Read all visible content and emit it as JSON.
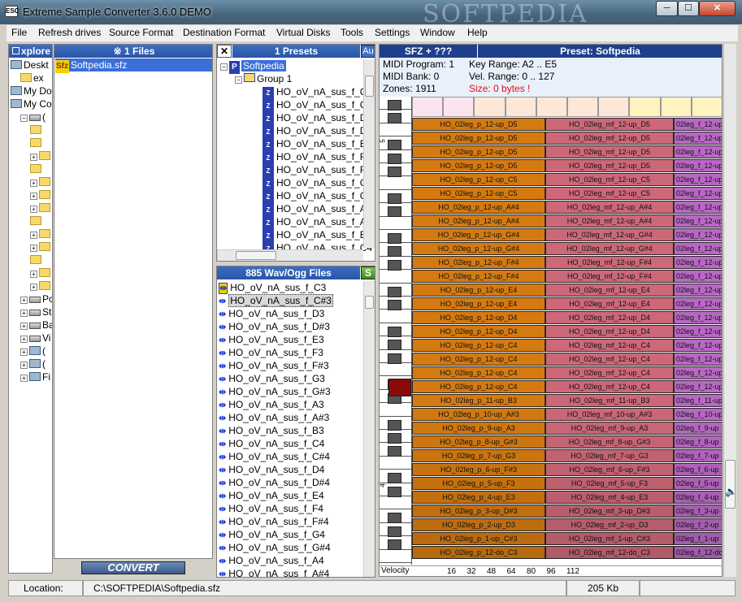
{
  "window": {
    "title": "Extreme Sample Converter 3.6.0 DEMO",
    "watermark": "SOFTPEDIA",
    "btn_min": "─",
    "btn_max": "☐",
    "btn_close": "✕"
  },
  "menu": [
    "File",
    "Refresh drives",
    "Source Format",
    "Destination Format",
    "Virtual Disks",
    "Tools",
    "Settings",
    "Window",
    "Help"
  ],
  "explorer": {
    "title": "xplore",
    "items": [
      {
        "label": "Deskt",
        "indent": 0,
        "icon": "pc",
        "exp": ""
      },
      {
        "label": "ex",
        "indent": 1,
        "icon": "folder",
        "exp": ""
      },
      {
        "label": "My Do",
        "indent": 0,
        "icon": "pc",
        "exp": ""
      },
      {
        "label": "My Co",
        "indent": 0,
        "icon": "pc",
        "exp": ""
      },
      {
        "label": "(",
        "indent": 1,
        "icon": "drive",
        "exp": "−"
      },
      {
        "label": "",
        "indent": 2,
        "icon": "folder",
        "exp": ""
      },
      {
        "label": "",
        "indent": 2,
        "icon": "folder",
        "exp": ""
      },
      {
        "label": "",
        "indent": 2,
        "icon": "folder",
        "exp": "+"
      },
      {
        "label": "",
        "indent": 2,
        "icon": "folder",
        "exp": ""
      },
      {
        "label": "",
        "indent": 2,
        "icon": "folder",
        "exp": "+"
      },
      {
        "label": "",
        "indent": 2,
        "icon": "folder",
        "exp": "+"
      },
      {
        "label": "",
        "indent": 2,
        "icon": "folder",
        "exp": "+"
      },
      {
        "label": "",
        "indent": 2,
        "icon": "folder",
        "exp": ""
      },
      {
        "label": "",
        "indent": 2,
        "icon": "folder",
        "exp": "+"
      },
      {
        "label": "",
        "indent": 2,
        "icon": "folder",
        "exp": "+"
      },
      {
        "label": "",
        "indent": 2,
        "icon": "folder",
        "exp": ""
      },
      {
        "label": "",
        "indent": 2,
        "icon": "folder",
        "exp": "+"
      },
      {
        "label": "",
        "indent": 2,
        "icon": "folder",
        "exp": "+"
      },
      {
        "label": "Pc",
        "indent": 1,
        "icon": "drive",
        "exp": "+"
      },
      {
        "label": "St",
        "indent": 1,
        "icon": "drive",
        "exp": "+"
      },
      {
        "label": "Ba",
        "indent": 1,
        "icon": "drive",
        "exp": "+"
      },
      {
        "label": "Vi",
        "indent": 1,
        "icon": "drive",
        "exp": "+"
      },
      {
        "label": "(",
        "indent": 1,
        "icon": "pc",
        "exp": "+"
      },
      {
        "label": "(",
        "indent": 1,
        "icon": "pc",
        "exp": "+"
      },
      {
        "label": "Fi",
        "indent": 1,
        "icon": "pc",
        "exp": "+"
      }
    ]
  },
  "files": {
    "title": "※ 1 Files",
    "items": [
      {
        "label": "Softpedia.sfz",
        "icon": "Sfz"
      }
    ],
    "convert": "CONVERT"
  },
  "presets": {
    "title": "1 Presets",
    "close": "✕",
    "au": "Au",
    "root": "Softpedia",
    "group": "Group 1",
    "items": [
      "HO_oV_nA_sus_f_C3",
      "HO_oV_nA_sus_f_C#",
      "HO_oV_nA_sus_f_D3",
      "HO_oV_nA_sus_f_D#",
      "HO_oV_nA_sus_f_E3",
      "HO_oV_nA_sus_f_F3",
      "HO_oV_nA_sus_f_F#",
      "HO_oV_nA_sus_f_G3",
      "HO_oV_nA_sus_f_G#",
      "HO_oV_nA_sus_f_A3",
      "HO_oV_nA_sus_f_A#",
      "HO_oV_nA_sus_f_B3",
      "HO_oV_nA_sus_f_C4"
    ]
  },
  "wavs": {
    "title": "885 Wav/Ogg Files",
    "btn": "S",
    "items": [
      "HO_oV_nA_sus_f_C3",
      "HO_oV_nA_sus_f_C#3",
      "HO_oV_nA_sus_f_D3",
      "HO_oV_nA_sus_f_D#3",
      "HO_oV_nA_sus_f_E3",
      "HO_oV_nA_sus_f_F3",
      "HO_oV_nA_sus_f_F#3",
      "HO_oV_nA_sus_f_G3",
      "HO_oV_nA_sus_f_G#3",
      "HO_oV_nA_sus_f_A3",
      "HO_oV_nA_sus_f_A#3",
      "HO_oV_nA_sus_f_B3",
      "HO_oV_nA_sus_f_C4",
      "HO_oV_nA_sus_f_C#4",
      "HO_oV_nA_sus_f_D4",
      "HO_oV_nA_sus_f_D#4",
      "HO_oV_nA_sus_f_E4",
      "HO_oV_nA_sus_f_F4",
      "HO_oV_nA_sus_f_F#4",
      "HO_oV_nA_sus_f_G4",
      "HO_oV_nA_sus_f_G#4",
      "HO_oV_nA_sus_f_A4",
      "HO_oV_nA_sus_f_A#4"
    ]
  },
  "preset_info": {
    "sfz_title": "SFZ + ???",
    "preset_title": "Preset: Softpedia",
    "midi_program": "MIDI Program:  1",
    "midi_bank": "MIDI Bank:      0",
    "zones": "Zones: 1911",
    "key_range": "Key Range:   A2 .. E5",
    "vel_range": "Vel. Range:   0 .. 127",
    "size": "Size:  0 bytes !"
  },
  "zones": [
    [
      "HO_02leg_p_12-up_D5",
      "HO_02leg_mf_12-up_D5",
      "02leg_f_12-up"
    ],
    [
      "HO_02leg_p_12-up_D5",
      "HO_02leg_mf_12-up_D5",
      "02leg_f_12-up"
    ],
    [
      "HO_02leg_p_12-up_D5",
      "HO_02leg_mf_12-up_D5",
      "02leg_f_12-up"
    ],
    [
      "HO_02leg_p_12-up_D5",
      "HO_02leg_mf_12-up_D5",
      "02leg_f_12-up"
    ],
    [
      "HO_02leg_p_12-up_C5",
      "HO_02leg_mf_12-up_C5",
      "02leg_f_12-up"
    ],
    [
      "HO_02leg_p_12-up_C5",
      "HO_02leg_mf_12-up_C5",
      "02leg_f_12-up"
    ],
    [
      "HO_02leg_p_12-up_A#4",
      "HO_02leg_mf_12-up_A#4",
      "02leg_f_12-up"
    ],
    [
      "HO_02leg_p_12-up_A#4",
      "HO_02leg_mf_12-up_A#4",
      "02leg_f_12-up"
    ],
    [
      "HO_02leg_p_12-up_G#4",
      "HO_02leg_mf_12-up_G#4",
      "02leg_f_12-up"
    ],
    [
      "HO_02leg_p_12-up_G#4",
      "HO_02leg_mf_12-up_G#4",
      "02leg_f_12-up"
    ],
    [
      "HO_02leg_p_12-up_F#4",
      "HO_02leg_mf_12-up_F#4",
      "02leg_f_12-up"
    ],
    [
      "HO_02leg_p_12-up_F#4",
      "HO_02leg_mf_12-up_F#4",
      "02leg_f_12-up"
    ],
    [
      "HO_02leg_p_12-up_E4",
      "HO_02leg_mf_12-up_E4",
      "02leg_f_12-up"
    ],
    [
      "HO_02leg_p_12-up_E4",
      "HO_02leg_mf_12-up_E4",
      "02leg_f_12-up"
    ],
    [
      "HO_02leg_p_12-up_D4",
      "HO_02leg_mf_12-up_D4",
      "02leg_f_12-up"
    ],
    [
      "HO_02leg_p_12-up_D4",
      "HO_02leg_mf_12-up_D4",
      "02leg_f_12-up"
    ],
    [
      "HO_02leg_p_12-up_C4",
      "HO_02leg_mf_12-up_C4",
      "02leg_f_12-up"
    ],
    [
      "HO_02leg_p_12-up_C4",
      "HO_02leg_mf_12-up_C4",
      "02leg_f_12-up"
    ],
    [
      "HO_02leg_p_12-up_C4",
      "HO_02leg_mf_12-up_C4",
      "02leg_f_12-up"
    ],
    [
      "HO_02leg_p_12-up_C4",
      "HO_02leg_mf_12-up_C4",
      "02leg_f_12-up"
    ],
    [
      "HO_02leg_p_11-up_B3",
      "HO_02leg_mf_11-up_B3",
      "02leg_f_11-up"
    ],
    [
      "HO_02leg_p_10-up_A#3",
      "HO_02leg_mf_10-up_A#3",
      "02leg_f_10-up"
    ],
    [
      "HO_02leg_p_9-up_A3",
      "HO_02leg_mf_9-up_A3",
      "02leg_f_9-up"
    ],
    [
      "HO_02leg_p_8-up_G#3",
      "HO_02leg_mf_8-up_G#3",
      "02leg_f_8-up"
    ],
    [
      "HO_02leg_p_7-up_G3",
      "HO_02leg_mf_7-up_G3",
      "02leg_f_7-up"
    ],
    [
      "HO_02leg_p_6-up_F#3",
      "HO_02leg_mf_6-up_F#3",
      "02leg_f_6-up"
    ],
    [
      "HO_02leg_p_5-up_F3",
      "HO_02leg_mf_5-up_F3",
      "02leg_f_5-up"
    ],
    [
      "HO_02leg_p_4-up_E3",
      "HO_02leg_mf_4-up_E3",
      "02leg_f_4-up"
    ],
    [
      "HO_02leg_p_3-up_D#3",
      "HO_02leg_mf_3-up_D#3",
      "02leg_f_3-up"
    ],
    [
      "HO_02leg_p_2-up_D3",
      "HO_02leg_mf_2-up_D3",
      "02leg_f_2-up"
    ],
    [
      "HO_02leg_p_1-up_C#3",
      "HO_02leg_mf_1-up_C#3",
      "02leg_f_1-up"
    ],
    [
      "HO_02leg_p_12-do_C3",
      "HO_02leg_mf_12-do_C3",
      "02leg_f_12-do"
    ]
  ],
  "zone_colors": {
    "p": "#d47a10",
    "mf": "#cc6878",
    "f": "#b868c4"
  },
  "octave_labels": [
    "5",
    "4",
    "3",
    "2"
  ],
  "velocity": {
    "label": "Velocity",
    "ticks": [
      "16",
      "32",
      "48",
      "64",
      "80",
      "96",
      "112"
    ]
  },
  "status": {
    "location_label": "Location:",
    "path": "C:\\SOFTPEDIA\\Softpedia.sfz",
    "size": "205 Kb"
  },
  "volume_icon": "🔈"
}
